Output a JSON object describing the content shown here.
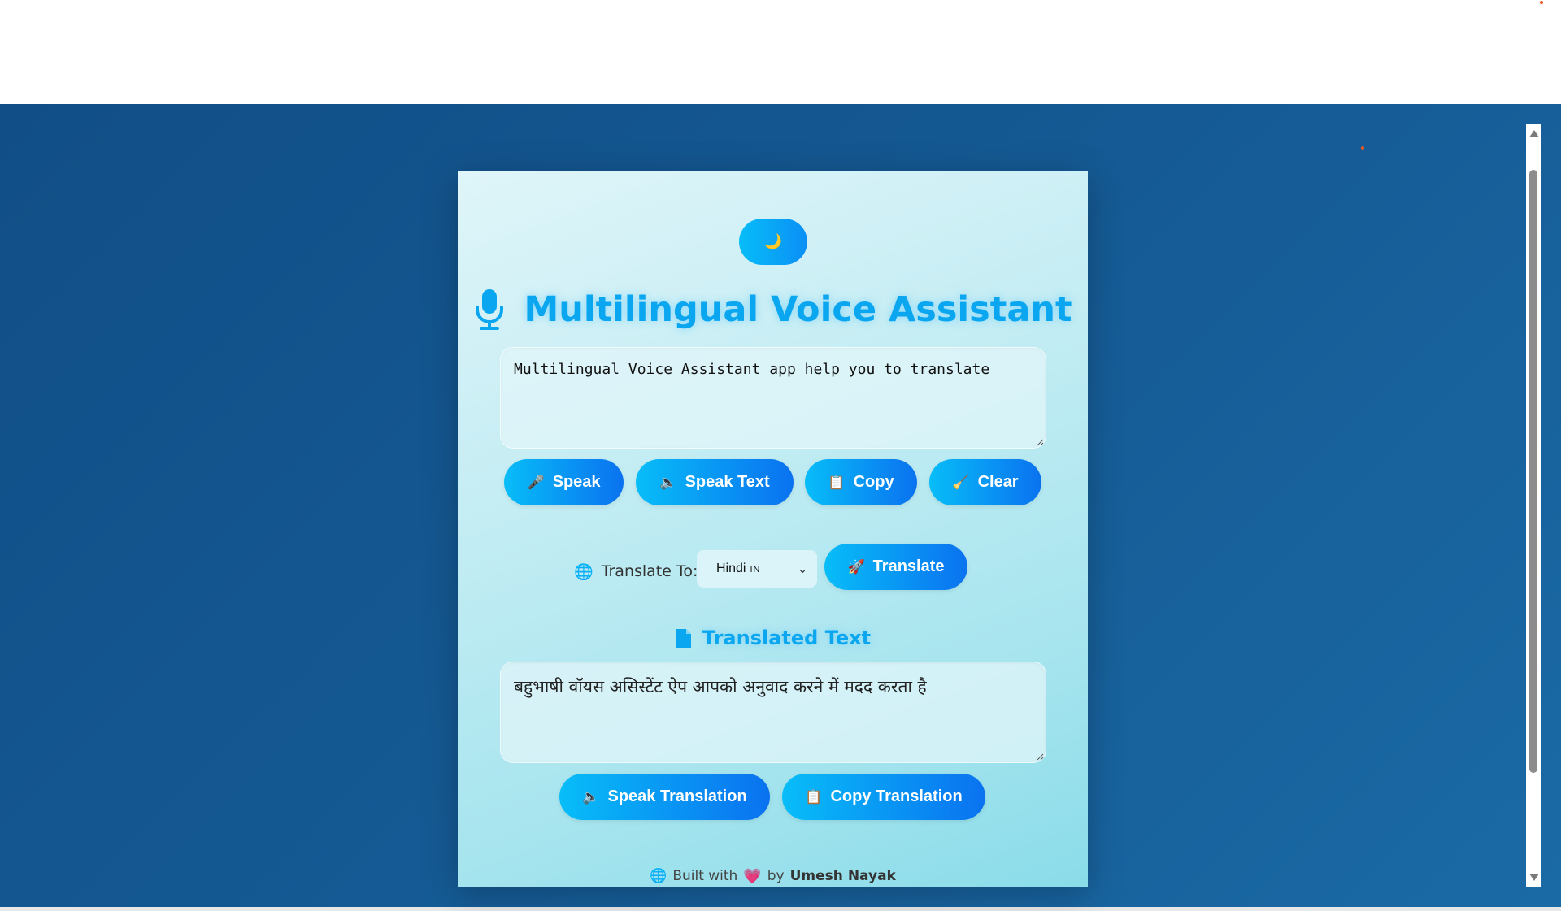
{
  "app": {
    "title": "Multilingual Voice Assistant",
    "theme_toggle_icon": "🌙"
  },
  "input": {
    "text": "Multilingual Voice Assistant app help you to translate"
  },
  "input_actions": [
    {
      "icon": "🎤",
      "label": "Speak"
    },
    {
      "icon": "🔈",
      "label": "Speak Text"
    },
    {
      "icon": "📋",
      "label": "Copy"
    },
    {
      "icon": "🧹",
      "label": "Clear"
    }
  ],
  "translate": {
    "label": "Translate To:",
    "selected_language": "Hindi",
    "selected_flag": "IN",
    "button_label": "Translate",
    "button_icon": "🚀"
  },
  "output": {
    "heading": "Translated Text",
    "text": "बहुभाषी वॉयस असिस्टेंट ऐप आपको अनुवाद करने में मदद करता है"
  },
  "output_actions": [
    {
      "icon": "🔈",
      "label": "Speak Translation"
    },
    {
      "icon": "📋",
      "label": "Copy Translation"
    }
  ],
  "footer": {
    "prefix": "Built with",
    "by": "by",
    "author": "Umesh Nayak",
    "heart": "💗",
    "globe": "🌐"
  },
  "colors": {
    "accent": "#0aa6f0",
    "button_start": "#08bdf8",
    "button_end": "#0a72f0",
    "background": "#155a94"
  }
}
